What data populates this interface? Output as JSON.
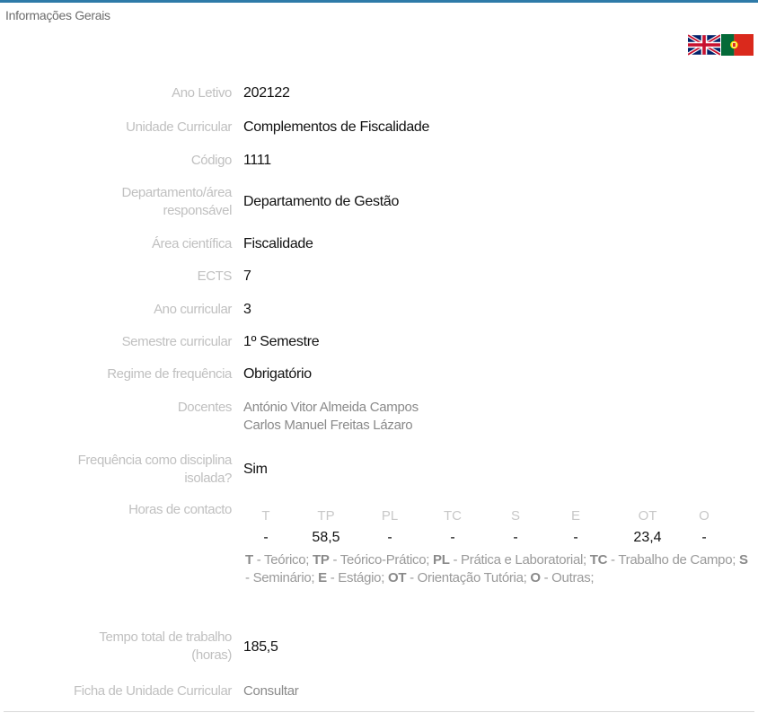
{
  "section_title": "Informações Gerais",
  "flags": {
    "english": "english-flag",
    "portuguese": "portuguese-flag"
  },
  "fields": {
    "ano_letivo": {
      "label": "Ano Letivo",
      "value": "202122"
    },
    "unidade_curricular": {
      "label": "Unidade Curricular",
      "value": "Complementos de Fiscalidade"
    },
    "codigo": {
      "label": "Código",
      "value": "1111"
    },
    "departamento": {
      "label_line1": "Departamento/área",
      "label_line2": "responsável",
      "value": "Departamento de Gestão"
    },
    "area_cientifica": {
      "label": "Área científica",
      "value": "Fiscalidade"
    },
    "ects": {
      "label": "ECTS",
      "value": "7"
    },
    "ano_curricular": {
      "label": "Ano curricular",
      "value": "3"
    },
    "semestre": {
      "label": "Semestre curricular",
      "value": "1º Semestre"
    },
    "regime": {
      "label": "Regime de frequência",
      "value": "Obrigatório"
    },
    "docentes": {
      "label": "Docentes",
      "value_line1": "António Vitor Almeida Campos",
      "value_line2": "Carlos Manuel Freitas Lázaro"
    },
    "isolada": {
      "label_line1": "Frequência como disciplina",
      "label_line2": "isolada?",
      "value": "Sim"
    },
    "horas": {
      "label": "Horas de contacto"
    },
    "tempo_total": {
      "label_line1": "Tempo total de trabalho",
      "label_line2": "(horas)",
      "value": "185,5"
    },
    "ficha": {
      "label": "Ficha de Unidade Curricular",
      "value": "Consultar"
    }
  },
  "hours": {
    "headers": [
      "T",
      "TP",
      "PL",
      "TC",
      "S",
      "E",
      "OT",
      "O"
    ],
    "values": [
      "-",
      "58,5",
      "-",
      "-",
      "-",
      "-",
      "23,4",
      "-"
    ]
  },
  "legend": [
    {
      "abbr": "T",
      "text": " - Teórico;"
    },
    {
      "abbr": "TP",
      "text": " - Teórico-Prático;"
    },
    {
      "abbr": "PL",
      "text": " - Prática e Laboratorial;"
    },
    {
      "abbr": "TC",
      "text": " - Trabalho de Campo;"
    },
    {
      "abbr": "S",
      "text": " - Seminário;"
    },
    {
      "abbr": "E",
      "text": " - Estágio;"
    },
    {
      "abbr": "OT",
      "text": " - Orientação Tutória;"
    },
    {
      "abbr": "O",
      "text": " - Outras;"
    }
  ]
}
